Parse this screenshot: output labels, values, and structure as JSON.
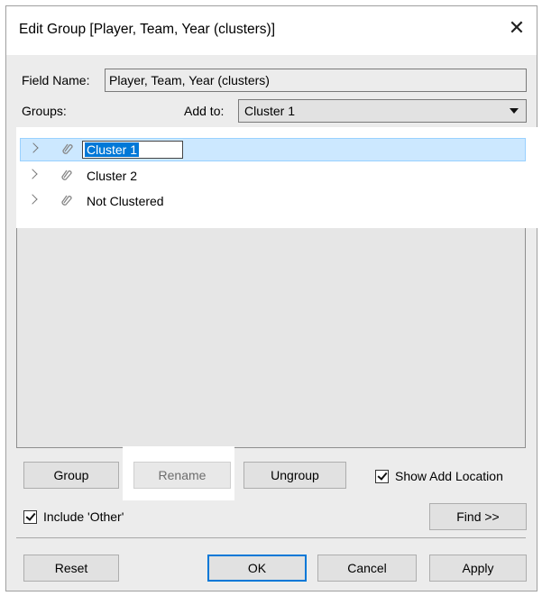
{
  "dialog": {
    "title": "Edit Group [Player, Team, Year (clusters)]",
    "close_glyph": "✕"
  },
  "field_name": {
    "label": "Field Name:",
    "value": "Player, Team, Year (clusters)"
  },
  "groups_label": "Groups:",
  "add_to": {
    "label": "Add to:",
    "selected": "Cluster 1"
  },
  "tree": {
    "items": [
      {
        "label": "Cluster 1",
        "selected": true,
        "editing": true,
        "icon": "paperclip-icon"
      },
      {
        "label": "Cluster 2",
        "selected": false,
        "icon": "paperclip-icon"
      },
      {
        "label": "Not Clustered",
        "selected": false,
        "icon": "paperclip-icon"
      }
    ]
  },
  "buttons": {
    "group": "Group",
    "rename": "Rename",
    "ungroup": "Ungroup",
    "find": "Find >>",
    "reset": "Reset",
    "ok": "OK",
    "cancel": "Cancel",
    "apply": "Apply"
  },
  "checkboxes": {
    "show_add_location": {
      "label": "Show Add Location",
      "checked": true
    },
    "include_other": {
      "label": "Include 'Other'",
      "checked": true
    }
  },
  "colors": {
    "selection": "#cce8ff",
    "text_selection": "#0078d7",
    "dialog_bg": "#ececec"
  }
}
